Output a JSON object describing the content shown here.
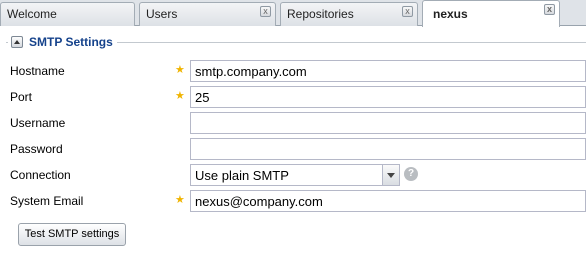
{
  "tabs": [
    {
      "label": "Welcome",
      "closable": false,
      "active": false
    },
    {
      "label": "Users",
      "closable": true,
      "active": false
    },
    {
      "label": "Repositories",
      "closable": true,
      "active": false
    },
    {
      "label": "nexus",
      "closable": true,
      "active": true
    }
  ],
  "close_glyph": "x",
  "section": {
    "title": "SMTP Settings",
    "collapse_icon": "triangle-up-icon"
  },
  "form": {
    "hostname": {
      "label": "Hostname",
      "value": "smtp.company.com",
      "required": true
    },
    "port": {
      "label": "Port",
      "value": "25",
      "required": true
    },
    "username": {
      "label": "Username",
      "value": "",
      "required": false
    },
    "password": {
      "label": "Password",
      "value": "",
      "required": false
    },
    "connection": {
      "label": "Connection",
      "value": "Use plain SMTP",
      "help_icon": "question-icon"
    },
    "system_email": {
      "label": "System Email",
      "value": "nexus@company.com",
      "required": true
    }
  },
  "required_glyph": "★",
  "help_glyph": "?",
  "test_button": {
    "label": "Test SMTP settings"
  },
  "colors": {
    "legend": "#15428b",
    "required_star": "#f0b400",
    "tab_bg": "#dfe3e8"
  }
}
